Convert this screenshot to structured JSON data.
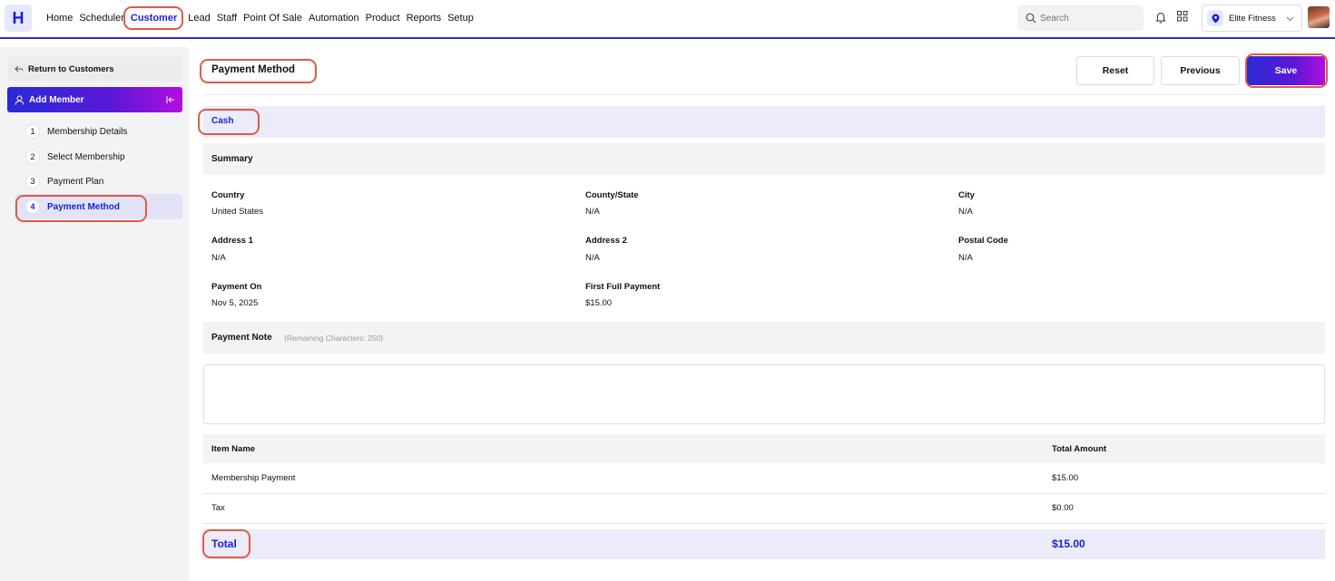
{
  "app": {
    "logo_letter": "H"
  },
  "nav": {
    "items": [
      "Home",
      "Scheduler",
      "Customer",
      "Lead",
      "Staff",
      "Point Of Sale",
      "Automation",
      "Product",
      "Reports",
      "Setup"
    ],
    "active": "Customer"
  },
  "search": {
    "placeholder": "Search"
  },
  "location": {
    "name": "Elite Fitness"
  },
  "sidebar": {
    "return_label": "Return to Customers",
    "section_label": "Add Member",
    "steps": [
      {
        "num": "1",
        "label": "Membership Details"
      },
      {
        "num": "2",
        "label": "Select Membership"
      },
      {
        "num": "3",
        "label": "Payment Plan"
      },
      {
        "num": "4",
        "label": "Payment Method"
      }
    ],
    "active_step": "4"
  },
  "header": {
    "title": "Payment Method",
    "reset_label": "Reset",
    "previous_label": "Previous",
    "save_label": "Save"
  },
  "payment": {
    "method": "Cash"
  },
  "summary": {
    "title": "Summary",
    "fields": {
      "country": {
        "label": "Country",
        "value": "United States"
      },
      "county_state": {
        "label": "County/State",
        "value": "N/A"
      },
      "city": {
        "label": "City",
        "value": "N/A"
      },
      "address1": {
        "label": "Address 1",
        "value": "N/A"
      },
      "address2": {
        "label": "Address 2",
        "value": "N/A"
      },
      "postal_code": {
        "label": "Postal Code",
        "value": "N/A"
      },
      "payment_on": {
        "label": "Payment On",
        "value": "Nov 5, 2025"
      },
      "first_full_payment": {
        "label": "First Full Payment",
        "value": "$15.00"
      }
    }
  },
  "note": {
    "title": "Payment Note",
    "remaining": "(Remaining Characters: 250)",
    "value": ""
  },
  "table": {
    "headers": {
      "item": "Item Name",
      "amount": "Total Amount"
    },
    "rows": [
      {
        "item": "Membership Payment",
        "amount": "$15.00"
      },
      {
        "item": "Tax",
        "amount": "$0.00"
      }
    ],
    "total": {
      "label": "Total",
      "amount": "$15.00"
    }
  },
  "colors": {
    "accent": "#2a2bd6",
    "gradient_end": "#b10ee0",
    "highlight_ring": "#e05a47",
    "active_bg": "#ebebfa"
  }
}
